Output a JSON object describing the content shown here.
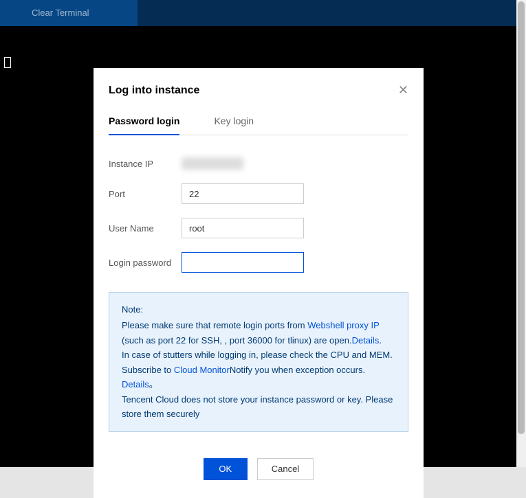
{
  "header": {
    "clear_terminal": "Clear Terminal"
  },
  "modal": {
    "title": "Log into instance",
    "tabs": {
      "password": "Password login",
      "key": "Key login"
    },
    "form": {
      "instance_ip_label": "Instance IP",
      "port_label": "Port",
      "port_value": "22",
      "username_label": "User Name",
      "username_value": "root",
      "password_label": "Login password",
      "password_value": ""
    },
    "note": {
      "title": "Note:",
      "line1_a": "Please make sure that remote login ports from ",
      "link1": "Webshell proxy IP",
      "line1_b": " (such as port 22 for SSH, , port 36000 for tlinux) are open.",
      "link_details1": "Details",
      "line1_end": ".",
      "line2": "In case of stutters while logging in, please check the CPU and MEM. Subscribe to ",
      "link_cloud_monitor": "Cloud Monitor",
      "line2_b": "Notify you when exception occurs. ",
      "link_details2": "Details",
      "line2_end": "。",
      "line3": "Tencent Cloud does not store your instance password or key. Please store them securely"
    },
    "footer": {
      "ok": "OK",
      "cancel": "Cancel"
    }
  }
}
